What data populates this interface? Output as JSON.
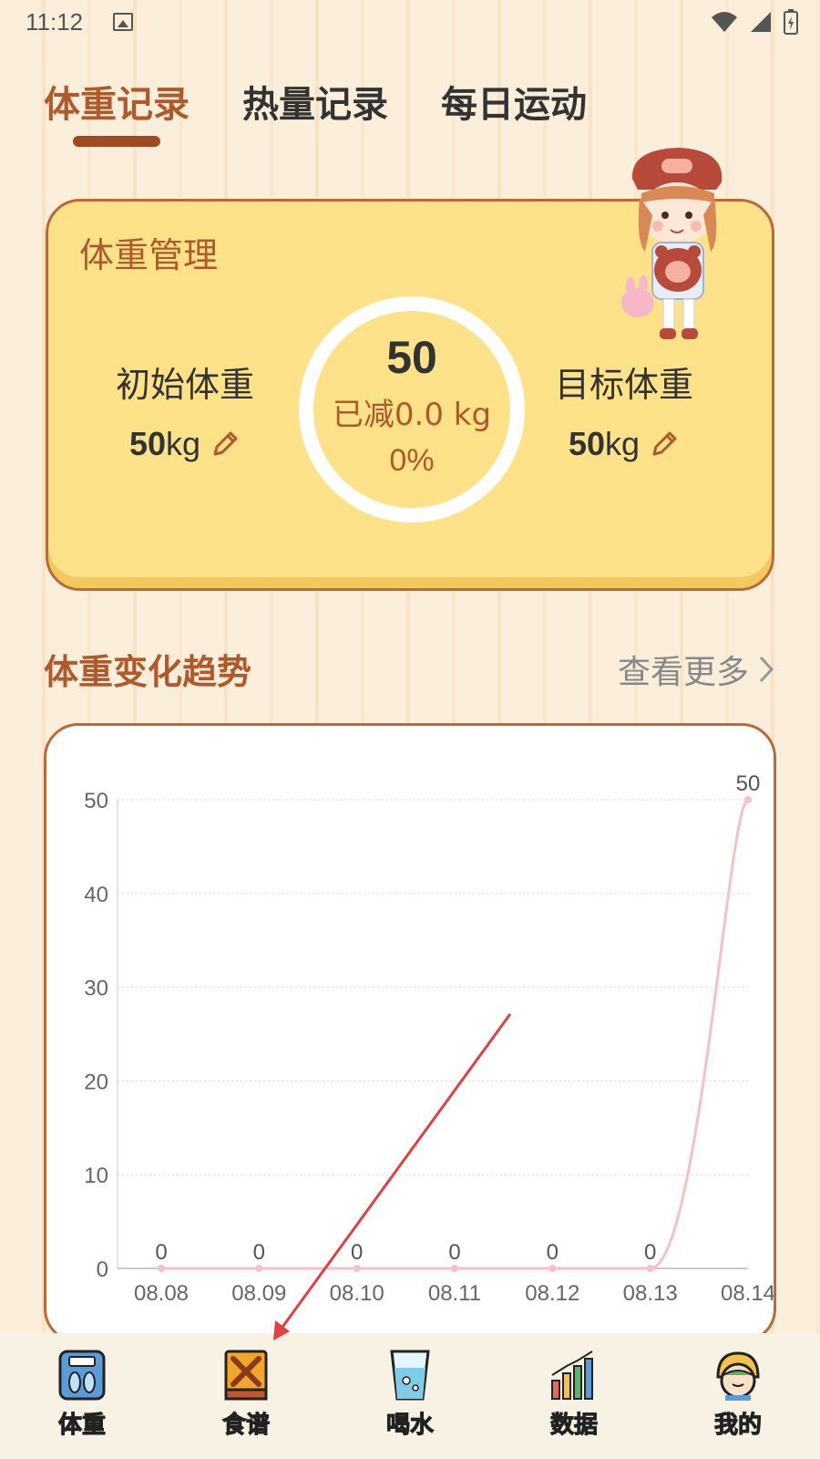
{
  "status_bar": {
    "time": "11:12"
  },
  "tabs": [
    {
      "label": "体重记录",
      "active": true
    },
    {
      "label": "热量记录",
      "active": false
    },
    {
      "label": "每日运动",
      "active": false
    }
  ],
  "weight_card": {
    "title": "体重管理",
    "initial_label": "初始体重",
    "initial_value": "50",
    "initial_unit": "kg",
    "target_label": "目标体重",
    "target_value": "50",
    "target_unit": "kg",
    "current": "50",
    "lost_text": "已减0.0 kg",
    "percent": "0%"
  },
  "trend": {
    "title": "体重变化趋势",
    "more_label": "查看更多"
  },
  "chart_data": {
    "type": "line",
    "categories": [
      "08.08",
      "08.09",
      "08.10",
      "08.11",
      "08.12",
      "08.13",
      "08.14"
    ],
    "values": [
      0,
      0,
      0,
      0,
      0,
      0,
      50
    ],
    "ylim": [
      0,
      50
    ],
    "yticks": [
      0,
      10,
      20,
      30,
      40,
      50
    ],
    "grid": true,
    "data_labels": true,
    "color": "#f6c1c6"
  },
  "bottom_nav": [
    {
      "label": "体重",
      "icon": "scale-icon"
    },
    {
      "label": "食谱",
      "icon": "recipe-book-icon"
    },
    {
      "label": "喝水",
      "icon": "water-glass-icon"
    },
    {
      "label": "数据",
      "icon": "bar-chart-icon"
    },
    {
      "label": "我的",
      "icon": "profile-avatar-icon"
    }
  ],
  "colors": {
    "accent": "#b0592a",
    "card_bg": "#fde289",
    "card_border": "#b96a37",
    "annotation_arrow": "#e04040"
  }
}
